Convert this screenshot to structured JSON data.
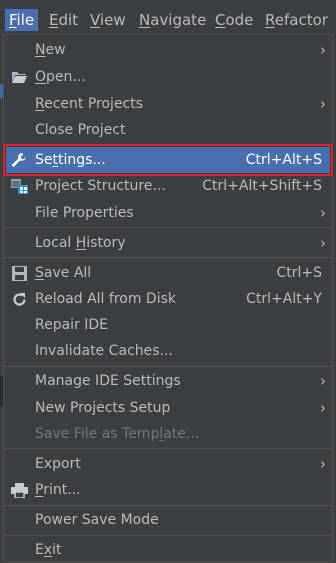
{
  "menubar": {
    "items": [
      {
        "label": "File",
        "mnemonic": "F",
        "rest": "ile"
      },
      {
        "label": "Edit",
        "mnemonic": "E",
        "rest": "dit"
      },
      {
        "label": "View",
        "mnemonic": "V",
        "rest": "iew"
      },
      {
        "label": "Navigate",
        "mnemonic": "N",
        "rest": "avigate"
      },
      {
        "label": "Code",
        "mnemonic": "C",
        "rest": "ode"
      },
      {
        "label": "Refactor",
        "mnemonic": "R",
        "rest": "efactor"
      }
    ]
  },
  "file_menu": {
    "new": {
      "pre": "",
      "mn": "N",
      "post": "ew"
    },
    "open": {
      "pre": "",
      "mn": "O",
      "post": "pen..."
    },
    "recent_projects": {
      "pre": "",
      "mn": "R",
      "post": "ecent Projects"
    },
    "close_project": {
      "pre": "Close Project",
      "mn": "",
      "post": ""
    },
    "settings": {
      "pre": "Se",
      "mn": "t",
      "post": "tings...",
      "shortcut": "Ctrl+Alt+S"
    },
    "project_structure": {
      "pre": "Project Structure...",
      "mn": "",
      "post": "",
      "shortcut": "Ctrl+Alt+Shift+S"
    },
    "file_properties": {
      "pre": "File Properties",
      "mn": "",
      "post": ""
    },
    "local_history": {
      "pre": "Local ",
      "mn": "H",
      "post": "istory"
    },
    "save_all": {
      "pre": "",
      "mn": "S",
      "post": "ave All",
      "shortcut": "Ctrl+S"
    },
    "reload_all": {
      "pre": "Reload All from Disk",
      "mn": "",
      "post": "",
      "shortcut": "Ctrl+Alt+Y"
    },
    "repair_ide": {
      "pre": "Repair IDE",
      "mn": "",
      "post": ""
    },
    "invalidate_caches": {
      "pre": "Invalidate Caches...",
      "mn": "",
      "post": ""
    },
    "manage_ide_settings": {
      "pre": "Manage IDE Settings",
      "mn": "",
      "post": ""
    },
    "new_projects_setup": {
      "pre": "New Projects Setup",
      "mn": "",
      "post": ""
    },
    "save_file_as_template": {
      "pre": "Save File as Temp",
      "mn": "l",
      "post": "ate..."
    },
    "export": {
      "pre": "Export",
      "mn": "",
      "post": ""
    },
    "print": {
      "pre": "",
      "mn": "P",
      "post": "rint..."
    },
    "power_save_mode": {
      "pre": "Power Save Mode",
      "mn": "",
      "post": ""
    },
    "exit": {
      "pre": "E",
      "mn": "x",
      "post": "it"
    }
  },
  "colors": {
    "menu_bg": "#3c3f41",
    "selection": "#4b6eaf",
    "highlight_border": "#e0202b",
    "text": "#bbbbbb",
    "disabled_text": "#777777"
  },
  "icons": {
    "submenu": "chevron-right-icon",
    "open": "folder-icon",
    "settings": "wrench-icon",
    "project_structure": "project-structure-icon",
    "save_all": "floppy-disk-icon",
    "reload": "reload-icon",
    "print": "printer-icon"
  }
}
